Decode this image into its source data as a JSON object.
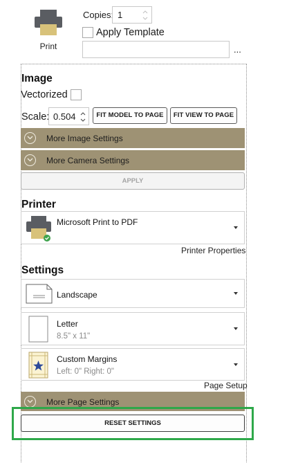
{
  "print": {
    "label": "Print",
    "icon": "printer-icon"
  },
  "copies": {
    "label": "Copies:",
    "value": "1"
  },
  "apply_template": {
    "label": "Apply Template",
    "checked": false,
    "value": "",
    "browse_label": "..."
  },
  "image": {
    "title": "Image",
    "vectorized_label": "Vectorized",
    "vectorized_checked": false,
    "scale_label": "Scale:",
    "scale_value": "0.504",
    "fit_model_label": "FIT MODEL TO PAGE",
    "fit_view_label": "FIT VIEW TO PAGE",
    "more_image_label": "More Image Settings",
    "more_camera_label": "More Camera Settings",
    "apply_label": "APPLY"
  },
  "printer": {
    "title": "Printer",
    "selected": "Microsoft Print to PDF",
    "properties_label": "Printer Properties"
  },
  "settings": {
    "title": "Settings",
    "orientation": "Landscape",
    "paper": "Letter",
    "paper_size": "8.5\" x 11\"",
    "margins": "Custom Margins",
    "margins_detail": "Left: 0\" Right: 0\"",
    "page_setup_label": "Page Setup",
    "more_page_label": "More Page Settings",
    "reset_label": "RESET SETTINGS"
  },
  "colors": {
    "band": "#9e9274",
    "highlight": "#2ea84a",
    "printer_body": "#5a5d62",
    "paper_tan": "#d8c27a",
    "status_green": "#3fa34d"
  }
}
